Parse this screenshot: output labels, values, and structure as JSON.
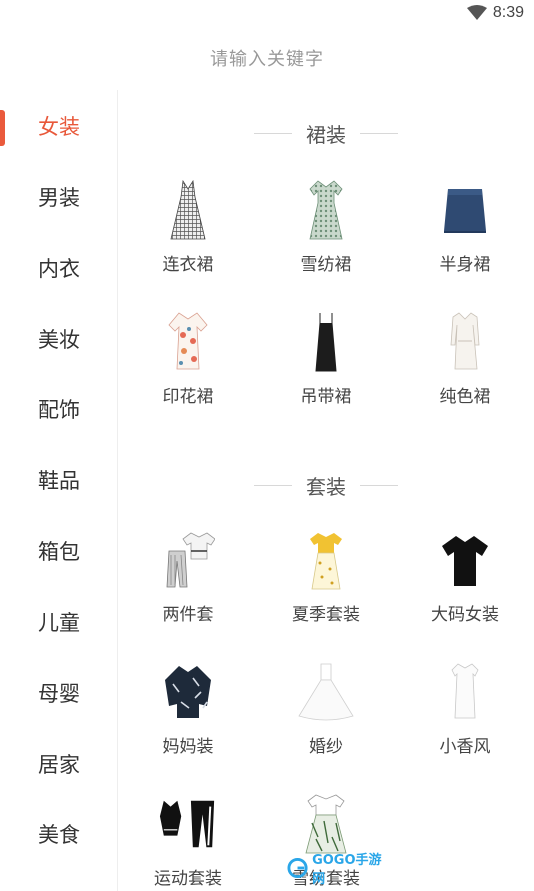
{
  "status_bar": {
    "time": "8:39",
    "icons": [
      "wifi-icon",
      "battery-icon"
    ]
  },
  "search": {
    "placeholder": "请输入关键字"
  },
  "colors": {
    "accent": "#e8583a",
    "divider": "#eeeeee",
    "text": "#333333",
    "hint": "#999999"
  },
  "sidebar": {
    "items": [
      {
        "label": "女装",
        "active": true
      },
      {
        "label": "男装"
      },
      {
        "label": "内衣"
      },
      {
        "label": "美妆"
      },
      {
        "label": "配饰"
      },
      {
        "label": "鞋品"
      },
      {
        "label": "箱包"
      },
      {
        "label": "儿童"
      },
      {
        "label": "母婴"
      },
      {
        "label": "居家"
      },
      {
        "label": "美食"
      }
    ]
  },
  "sections": [
    {
      "title": "裙装",
      "items": [
        {
          "label": "连衣裙",
          "icon": "plaid-dress-icon"
        },
        {
          "label": "雪纺裙",
          "icon": "chiffon-dress-icon"
        },
        {
          "label": "半身裙",
          "icon": "denim-skirt-icon"
        },
        {
          "label": "印花裙",
          "icon": "print-dress-icon"
        },
        {
          "label": "吊带裙",
          "icon": "slip-dress-icon"
        },
        {
          "label": "纯色裙",
          "icon": "solid-dress-icon"
        }
      ]
    },
    {
      "title": "套装",
      "items": [
        {
          "label": "两件套",
          "icon": "two-piece-icon"
        },
        {
          "label": "夏季套装",
          "icon": "summer-set-icon"
        },
        {
          "label": "大码女装",
          "icon": "plus-size-tee-icon"
        },
        {
          "label": "妈妈装",
          "icon": "mom-blouse-icon"
        },
        {
          "label": "婚纱",
          "icon": "wedding-dress-icon"
        },
        {
          "label": "小香风",
          "icon": "chanel-style-dress-icon"
        },
        {
          "label": "运动套装",
          "icon": "sports-set-icon"
        },
        {
          "label": "雪纺套装",
          "icon": "chiffon-set-icon"
        }
      ]
    }
  ],
  "watermark": {
    "text": "GOGO手游网"
  }
}
